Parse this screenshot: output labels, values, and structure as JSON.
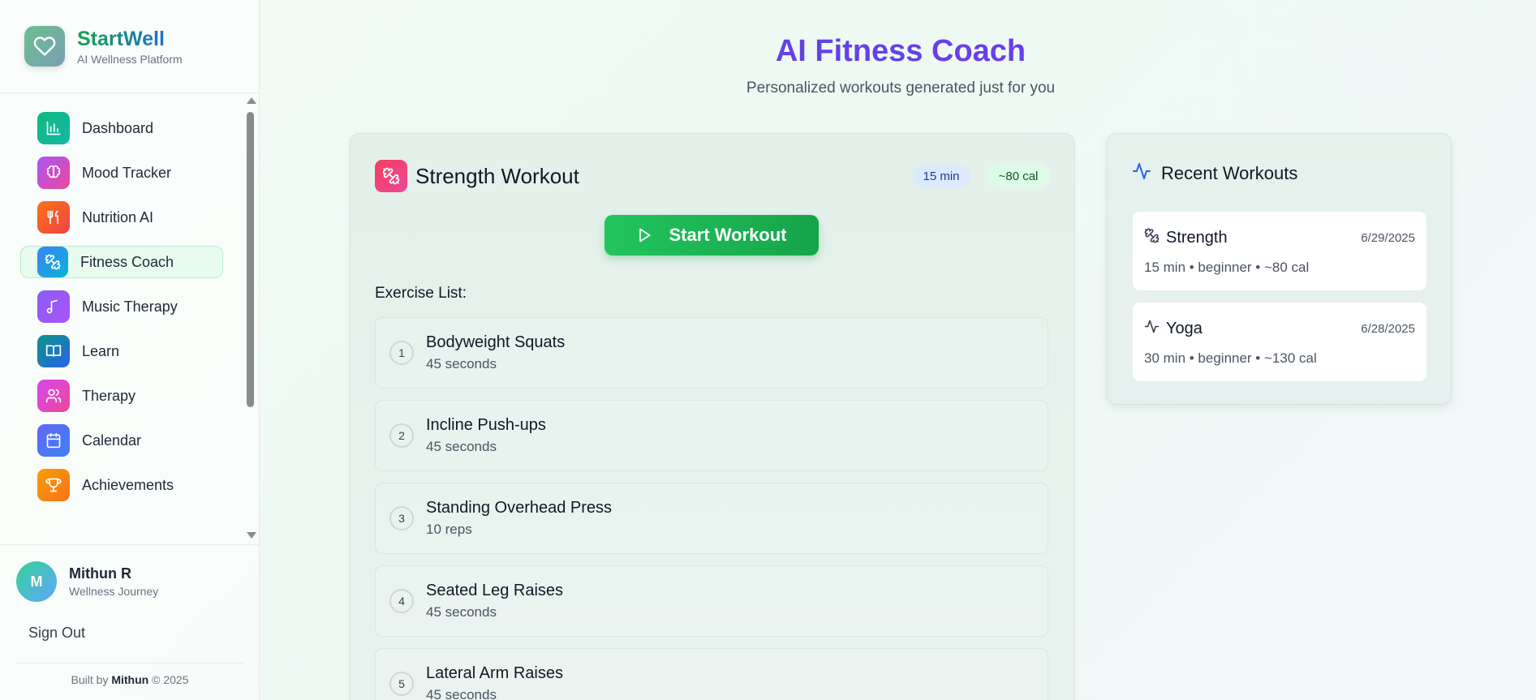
{
  "brand": {
    "name": "StartWell",
    "subtitle": "AI Wellness Platform",
    "icon": "heart-icon"
  },
  "sidebar": {
    "items": [
      {
        "label": "Dashboard",
        "icon": "bar-chart-icon",
        "color": "#10b981"
      },
      {
        "label": "Mood Tracker",
        "icon": "brain-icon",
        "color": "#a855f7"
      },
      {
        "label": "Nutrition AI",
        "icon": "utensils-icon",
        "color": "#f97316"
      },
      {
        "label": "Fitness Coach",
        "icon": "dumbbell-icon",
        "color": "#0ea5e9",
        "active": true
      },
      {
        "label": "Music Therapy",
        "icon": "music-note-icon",
        "color": "#8b5cf6"
      },
      {
        "label": "Learn",
        "icon": "book-icon",
        "color": "#0d9488"
      },
      {
        "label": "Therapy",
        "icon": "users-icon",
        "color": "#d946ef"
      },
      {
        "label": "Calendar",
        "icon": "calendar-icon",
        "color": "#6366f1"
      },
      {
        "label": "Achievements",
        "icon": "trophy-icon",
        "color": "#f59e0b"
      }
    ]
  },
  "user": {
    "initial": "M",
    "name": "Mithun R",
    "subtitle": "Wellness Journey"
  },
  "sign_out": "Sign Out",
  "footer": {
    "prefix": "Built by",
    "author": "Mithun",
    "suffix": "© 2025"
  },
  "header": {
    "title": "AI Fitness Coach",
    "subtitle": "Personalized workouts generated just for you"
  },
  "workout": {
    "title": "Strength Workout",
    "duration_badge": "15 min",
    "calories_badge": "~80 cal",
    "start_label": "Start Workout",
    "exercise_heading": "Exercise List:",
    "exercises": [
      {
        "num": "1",
        "name": "Bodyweight Squats",
        "detail": "45 seconds"
      },
      {
        "num": "2",
        "name": "Incline Push-ups",
        "detail": "45 seconds"
      },
      {
        "num": "3",
        "name": "Standing Overhead Press",
        "detail": "10 reps"
      },
      {
        "num": "4",
        "name": "Seated Leg Raises",
        "detail": "45 seconds"
      },
      {
        "num": "5",
        "name": "Lateral Arm Raises",
        "detail": "45 seconds"
      }
    ]
  },
  "recent": {
    "title": "Recent Workouts",
    "items": [
      {
        "name": "Strength",
        "date": "6/29/2025",
        "meta": "15 min • beginner • ~80 cal",
        "icon": "dumbbell-icon"
      },
      {
        "name": "Yoga",
        "date": "6/28/2025",
        "meta": "30 min • beginner • ~130 cal",
        "icon": "activity-icon"
      }
    ]
  }
}
